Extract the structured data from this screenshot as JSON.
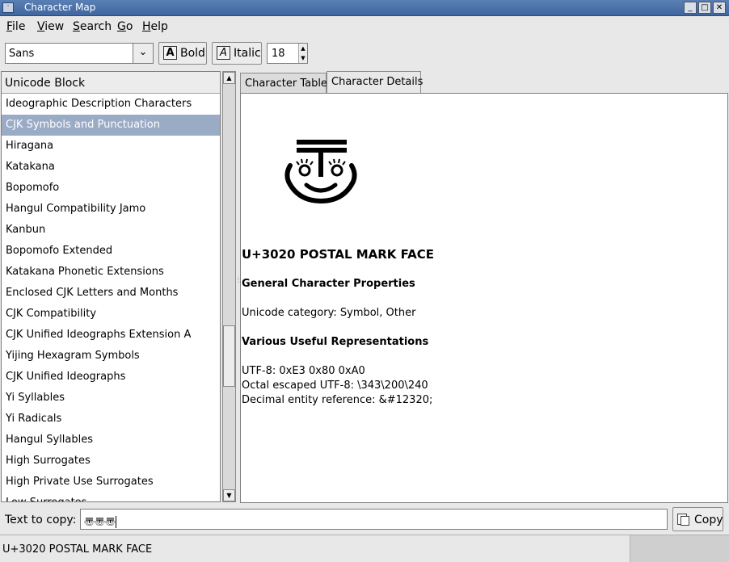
{
  "window": {
    "title": "Character Map",
    "controls": {
      "minimize": "_",
      "maximize": "□",
      "close": "✕"
    }
  },
  "menu": {
    "file": "File",
    "view": "View",
    "search": "Search",
    "go": "Go",
    "help": "Help"
  },
  "toolbar": {
    "font": "Sans",
    "bold_label": "Bold",
    "italic_label": "Italic",
    "size": "18"
  },
  "blocks": {
    "header": "Unicode Block",
    "selected": "CJK Symbols and Punctuation",
    "items": [
      "Ideographic Description Characters",
      "CJK Symbols and Punctuation",
      "Hiragana",
      "Katakana",
      "Bopomofo",
      "Hangul Compatibility Jamo",
      "Kanbun",
      "Bopomofo Extended",
      "Katakana Phonetic Extensions",
      "Enclosed CJK Letters and Months",
      "CJK Compatibility",
      "CJK Unified Ideographs Extension A",
      "Yijing Hexagram Symbols",
      "CJK Unified Ideographs",
      "Yi Syllables",
      "Yi Radicals",
      "Hangul Syllables",
      "High Surrogates",
      "High Private Use Surrogates",
      "Low Surrogates"
    ]
  },
  "tabs": {
    "table": "Character Table",
    "details": "Character Details",
    "active": "details"
  },
  "details": {
    "name": "U+3020 POSTAL MARK FACE",
    "general_heading": "General Character Properties",
    "category": "Unicode category: Symbol, Other",
    "repr_heading": "Various Useful Representations",
    "utf8": "UTF-8: 0xE3 0x80 0xA0",
    "octal": "Octal escaped UTF-8: \\343\\200\\240",
    "decimal": "Decimal entity reference: &#12320;"
  },
  "copy": {
    "label": "Text to copy:",
    "value": "〠〠〠",
    "button": "Copy"
  },
  "status": {
    "text": "U+3020 POSTAL MARK FACE"
  }
}
